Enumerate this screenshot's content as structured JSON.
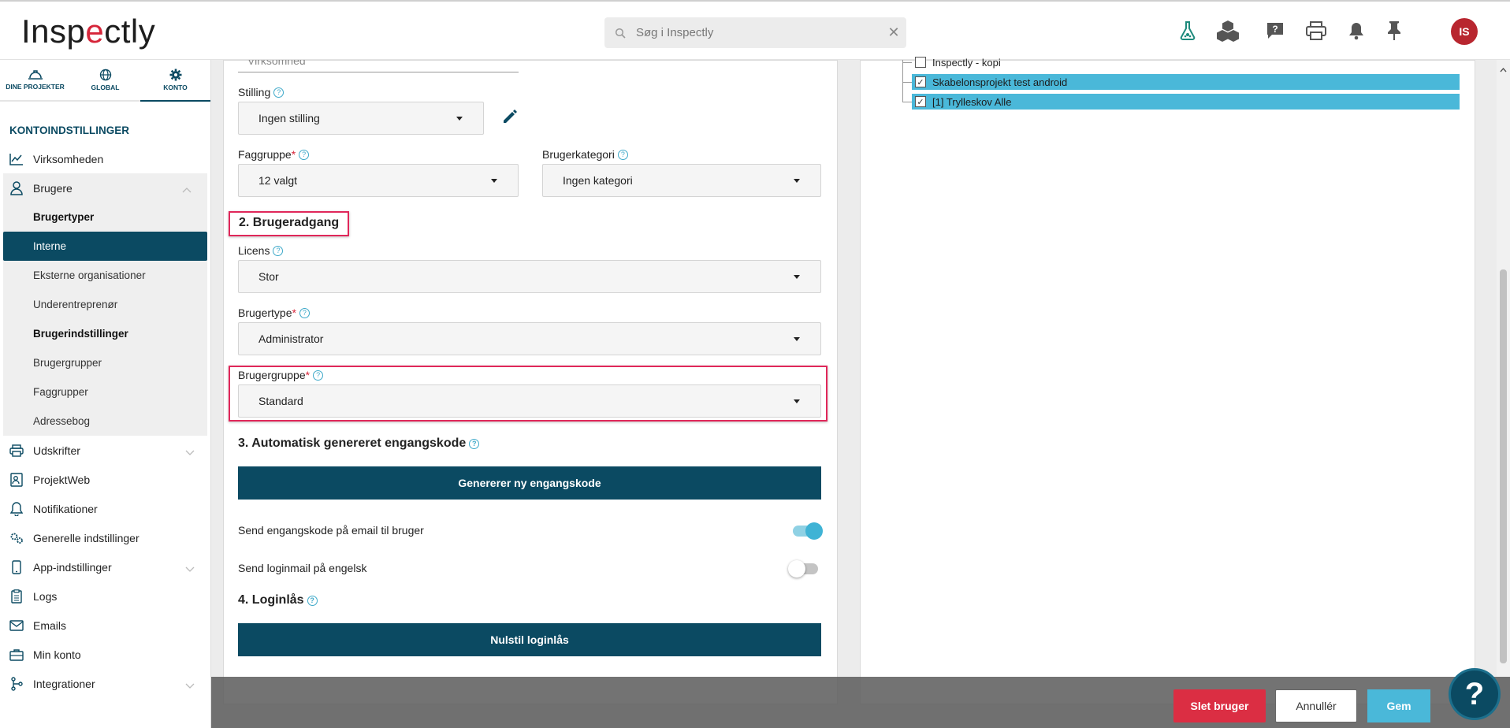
{
  "app": {
    "logo_text_a": "Insp",
    "logo_text_c": "e",
    "logo_text_b": "ctly"
  },
  "search": {
    "placeholder": "Søg i Inspectly"
  },
  "header_icons": [
    "flask-icon",
    "cubes-icon",
    "help-chat-icon",
    "printer-icon",
    "bell-icon",
    "pin-icon"
  ],
  "user": {
    "initials": "IS",
    "avatar_color": "#b8262f"
  },
  "sidebar": {
    "tabs": [
      {
        "label": "DINE PROJEKTER",
        "icon": "helmet-icon"
      },
      {
        "label": "GLOBAL",
        "icon": "globe-icon"
      },
      {
        "label": "KONTO",
        "icon": "gear-icon",
        "active": true
      }
    ],
    "section_title": "KONTOINDSTILLINGER",
    "items": {
      "virksomheden": "Virksomheden",
      "brugere": "Brugere",
      "udskrifter": "Udskrifter",
      "projektweb": "ProjektWeb",
      "notifikationer": "Notifikationer",
      "generelle": "Generelle indstillinger",
      "app": "App-indstillinger",
      "logs": "Logs",
      "emails": "Emails",
      "minkonto": "Min konto",
      "integrationer": "Integrationer"
    },
    "brugere_sub": {
      "brugertyper": "Brugertyper",
      "interne": "Interne",
      "eksterne": "Eksterne organisationer",
      "underentreprenor": "Underentreprenør",
      "brugerindstillinger": "Brugerindstillinger",
      "brugergrupper": "Brugergrupper",
      "faggrupper": "Faggrupper",
      "adressebog": "Adressebog"
    }
  },
  "form": {
    "virksomhed_value": "Virksomhed",
    "stilling": {
      "label": "Stilling",
      "value": "Ingen stilling"
    },
    "faggruppe": {
      "label": "Faggruppe",
      "req": "*",
      "value": "12 valgt"
    },
    "brugerkategori": {
      "label": "Brugerkategori",
      "value": "Ingen kategori"
    },
    "section2": "2. Brugeradgang",
    "licens": {
      "label": "Licens",
      "value": "Stor"
    },
    "brugertype": {
      "label": "Brugertype",
      "req": "*",
      "value": "Administrator"
    },
    "brugergruppe": {
      "label": "Brugergruppe",
      "req": "*",
      "value": "Standard"
    },
    "section3": "3. Automatisk genereret engangskode",
    "generate_btn": "Genererer ny engangskode",
    "send_email_label": "Send engangskode på email til bruger",
    "send_email_on": true,
    "send_english_label": "Send loginmail på engelsk",
    "send_english_on": false,
    "section4": "4. Loginlås",
    "reset_btn": "Nulstil loginlås"
  },
  "projects": {
    "items": [
      {
        "label": "Inspectly - kopi",
        "checked": false,
        "selected": false
      },
      {
        "label": "Skabelonsprojekt test android",
        "checked": true,
        "selected": true
      },
      {
        "label": "[1] Trylleskov Alle",
        "checked": true,
        "selected": true
      }
    ]
  },
  "footer": {
    "delete": "Slet bruger",
    "cancel": "Annullér",
    "save": "Gem",
    "help": "?"
  },
  "colors": {
    "primary": "#0b4a62",
    "accent": "#4ab8d9",
    "danger": "#db2e43",
    "highlight": "#e0275a"
  }
}
